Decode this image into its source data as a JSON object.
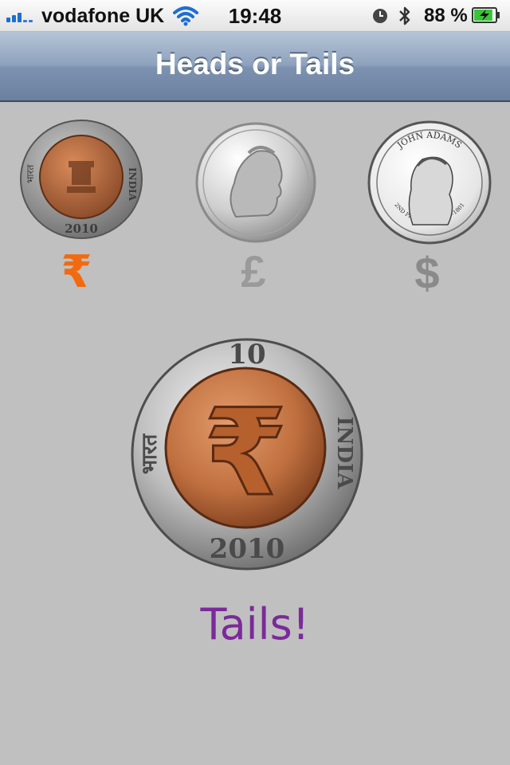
{
  "status_bar": {
    "carrier": "vodafone UK",
    "time": "19:48",
    "battery_percent": "88 %",
    "battery_level": 0.88,
    "icons": [
      "signal-icon",
      "wifi-icon",
      "alarm-clock-icon",
      "bluetooth-icon",
      "battery-icon"
    ]
  },
  "nav": {
    "title": "Heads or Tails"
  },
  "currencies": [
    {
      "id": "rupee",
      "coin_rim_text": "2010",
      "coin_left_text": "भारत",
      "coin_right_text": "INDIA",
      "symbol": "₹",
      "selected": true,
      "symbol_color": "#f26a10"
    },
    {
      "id": "pound",
      "coin_rim_text": "",
      "symbol": "£",
      "selected": false,
      "symbol_color": "#9a9a9a"
    },
    {
      "id": "dollar",
      "coin_rim_text": "JOHN ADAMS",
      "coin_bottom_text": "2ND PRESIDENT 1797-1801",
      "symbol": "$",
      "selected": false,
      "symbol_color": "#8a8a8a"
    }
  ],
  "result": {
    "coin": {
      "top_text": "10",
      "bottom_text": "2010",
      "left_text": "भारत",
      "right_text": "INDIA",
      "symbol": "₹"
    },
    "text": "Tails!",
    "color": "#7b2a9a"
  }
}
